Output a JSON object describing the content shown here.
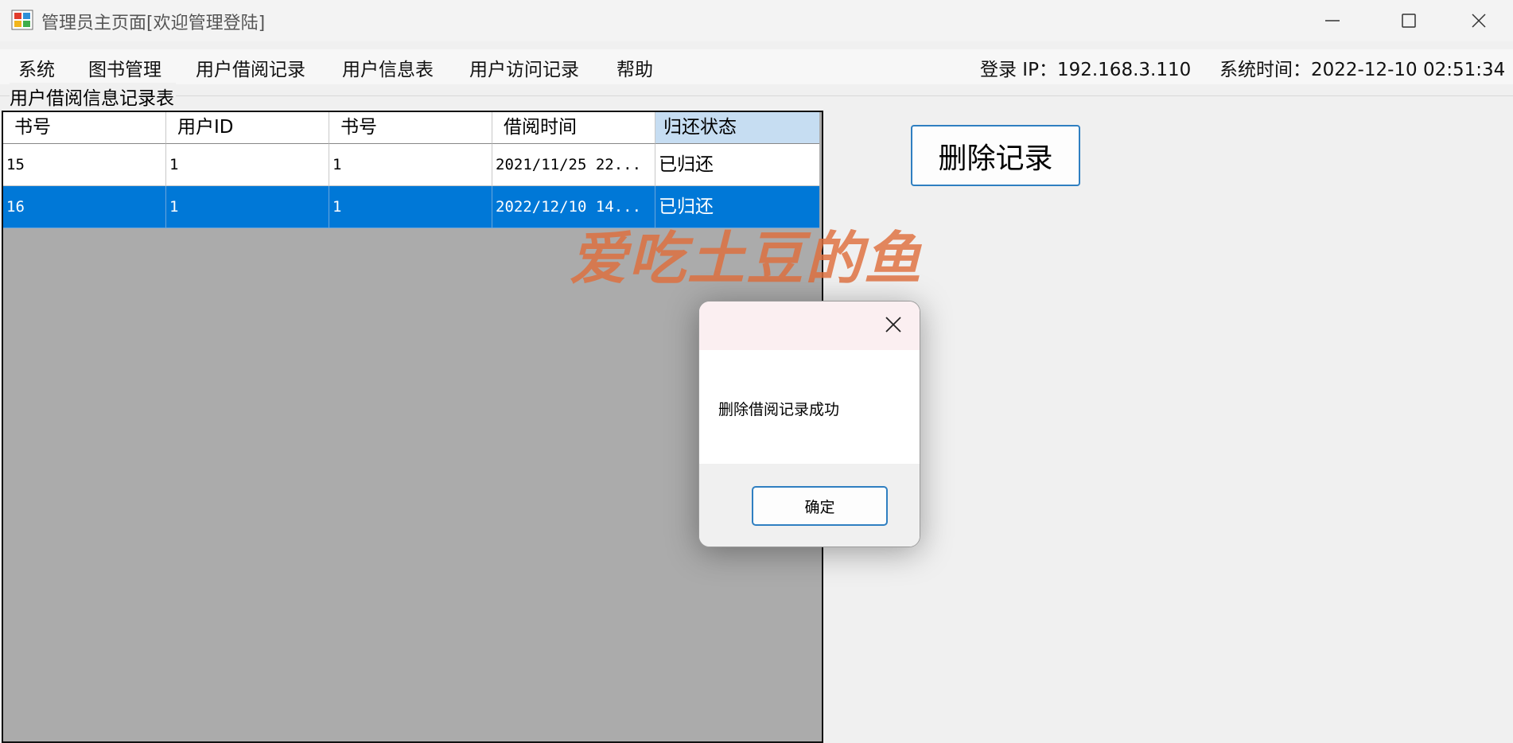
{
  "window": {
    "title": "管理员主页面[欢迎管理登陆]"
  },
  "menu": {
    "items": [
      "系统",
      "图书管理",
      "用户借阅记录",
      "用户信息表",
      "用户访问记录",
      "帮助"
    ],
    "login_ip": "登录 IP：192.168.3.110",
    "system_time": "系统时间：2022-12-10 02:51:34"
  },
  "group_label": "用户借阅信息记录表",
  "table": {
    "headers": [
      "书号",
      "用户ID",
      "书号",
      "借阅时间",
      "归还状态"
    ],
    "rows": [
      [
        "15",
        "1",
        "1",
        "2021/11/25 22...",
        "已归还"
      ],
      [
        "16",
        "1",
        "1",
        "2022/12/10 14...",
        "已归还"
      ]
    ],
    "selected_row_index": 1
  },
  "actions": {
    "delete_label": "删除记录"
  },
  "watermark": "爱吃土豆的鱼",
  "dialog": {
    "message": "删除借阅记录成功",
    "ok_label": "确定"
  },
  "colors": {
    "selection": "#0078d7",
    "accent_border": "#2f7fc1",
    "grid_background": "#ababab",
    "selected_header": "#c6ddf2",
    "watermark": "#de6e3c"
  }
}
